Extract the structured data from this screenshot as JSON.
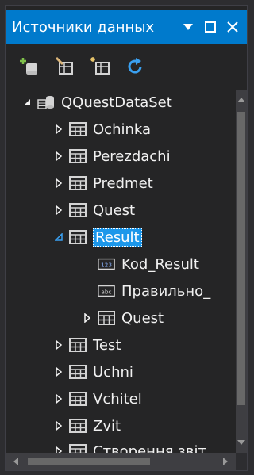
{
  "title": "Источники данных",
  "title_buttons": {
    "dropdown": "▼",
    "maximize": "□",
    "close": "✕"
  },
  "toolbar": {
    "add_source_icon": "add-datasource-icon",
    "edit_dataset_icon": "edit-dataset-icon",
    "configure_icon": "configure-dataset-icon",
    "refresh_icon": "refresh-icon"
  },
  "tree": {
    "root": {
      "label": "QQuestDataSet",
      "icon": "dataset-icon",
      "expanded": true
    },
    "items": [
      {
        "label": "Ochinka",
        "icon": "table-icon",
        "expanded": false
      },
      {
        "label": "Perezdachi",
        "icon": "table-icon",
        "expanded": false
      },
      {
        "label": "Predmet",
        "icon": "table-icon",
        "expanded": false
      },
      {
        "label": "Quest",
        "icon": "table-icon",
        "expanded": false
      },
      {
        "label": "Result",
        "icon": "table-icon",
        "expanded": true,
        "selected": true,
        "children": [
          {
            "label": "Kod_Result",
            "icon": "numeric-field-icon"
          },
          {
            "label": "Правильно_",
            "icon": "text-field-icon"
          },
          {
            "label": "Quest",
            "icon": "table-icon",
            "expanded": false
          }
        ]
      },
      {
        "label": "Test",
        "icon": "table-icon",
        "expanded": false
      },
      {
        "label": "Uchni",
        "icon": "table-icon",
        "expanded": false
      },
      {
        "label": "Vchitel",
        "icon": "table-icon",
        "expanded": false
      },
      {
        "label": "Zvit",
        "icon": "table-icon",
        "expanded": false
      },
      {
        "label": "Створення звіт",
        "icon": "table-icon",
        "expanded": false
      }
    ]
  },
  "icon_glyphs": {
    "numeric": "123",
    "text": "abc"
  },
  "colors": {
    "accent": "#007acc",
    "selection": "#1c97ea",
    "background": "#252526"
  }
}
